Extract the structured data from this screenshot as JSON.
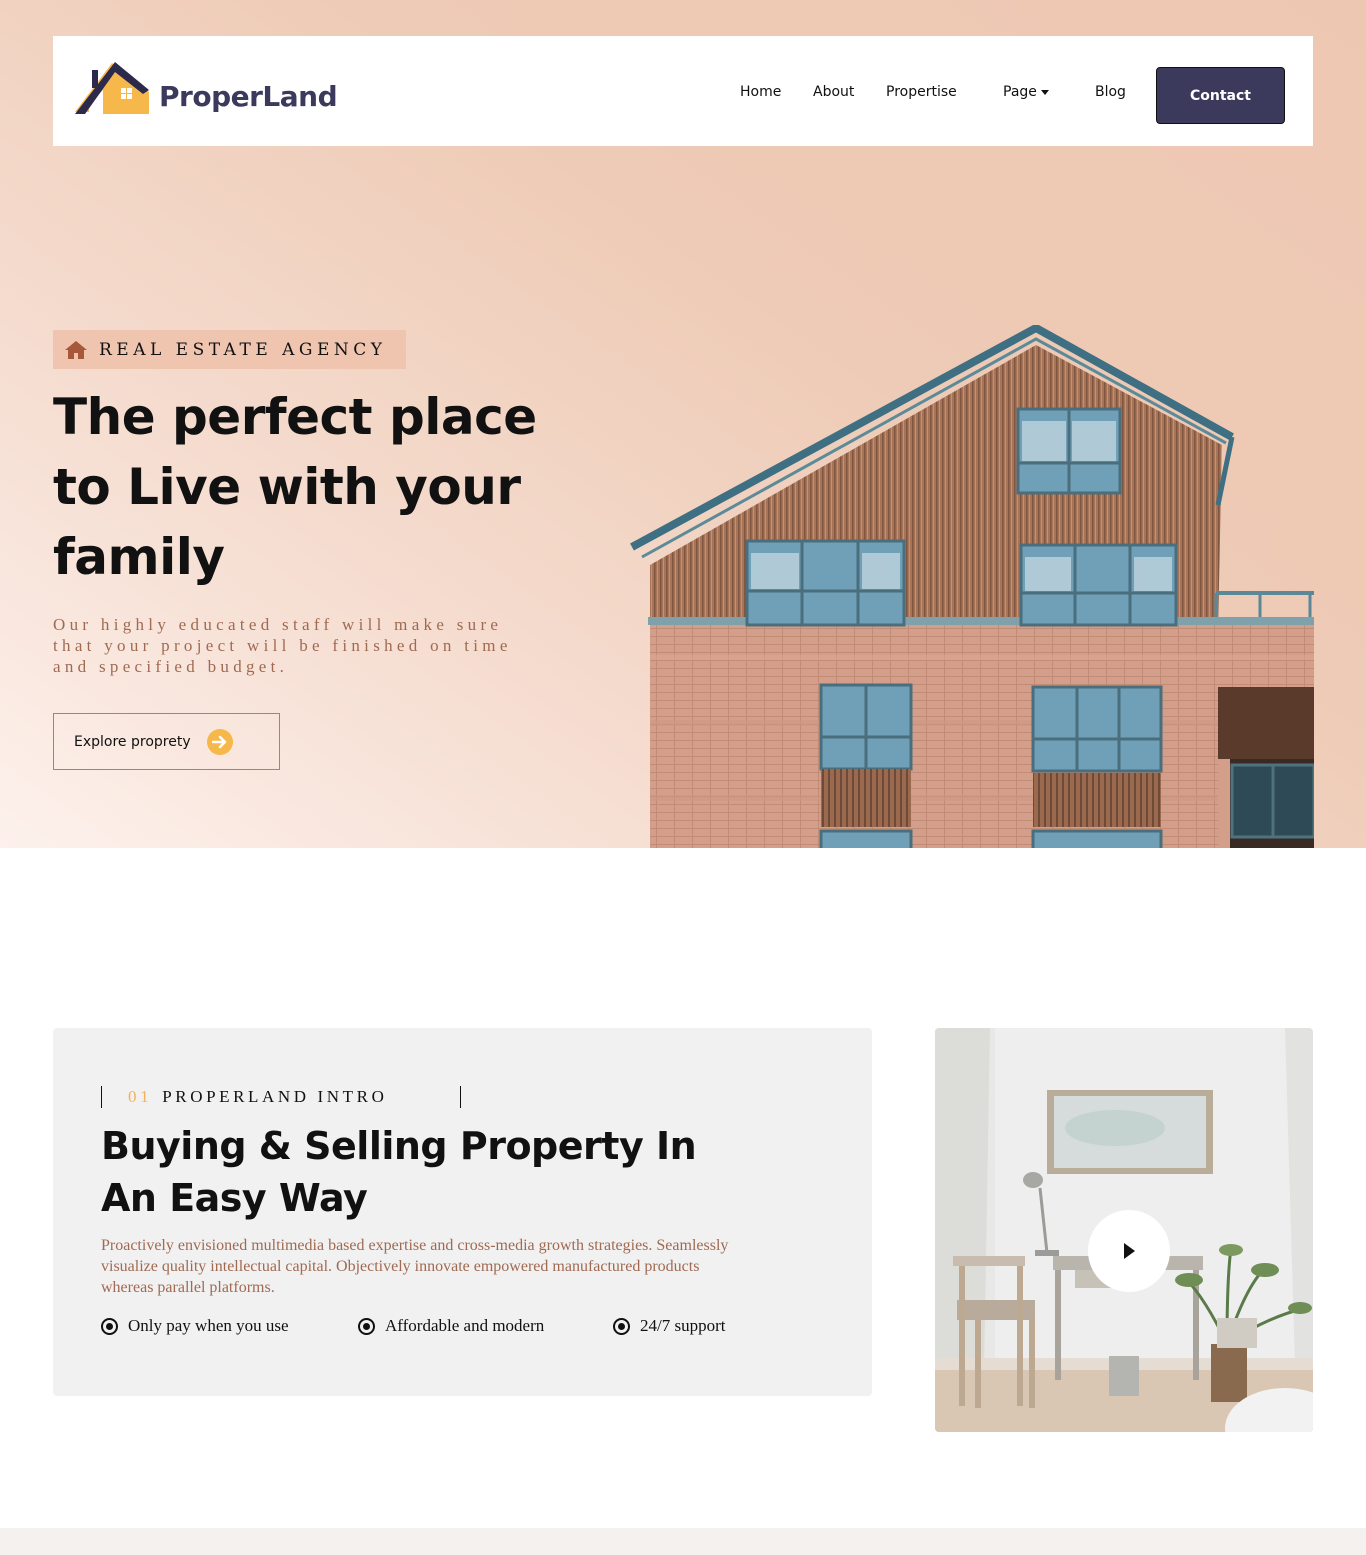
{
  "brand": {
    "name": "ProperLand",
    "colors": {
      "dark": "#3b3a5c",
      "accent": "#f7b84b",
      "muted": "#a06a52",
      "peach": "#eec7b2"
    }
  },
  "nav": {
    "items": [
      {
        "label": "Home"
      },
      {
        "label": "About"
      },
      {
        "label": "Propertise"
      },
      {
        "label": "Page",
        "has_dropdown": true
      },
      {
        "label": "Blog"
      }
    ],
    "contact_label": "Contact"
  },
  "hero": {
    "tagline": "REAL ESTATE AGENCY",
    "tagline_icon": "home-icon",
    "title": "The perfect place to Live with your family",
    "description": "Our highly educated staff will make sure that your project will be finished on time and specified budget.",
    "cta_label": "Explore proprety",
    "cta_icon": "arrow-right-icon"
  },
  "intro": {
    "number": "01",
    "label": "PROPERLAND INTRO",
    "title": "Buying & Selling Property In An Easy Way",
    "description": "Proactively envisioned multimedia based expertise and cross-media growth strategies. Seamlessly visualize quality intellectual capital. Objectively innovate empowered manufactured products whereas parallel platforms.",
    "features": [
      {
        "label": "Only pay when you use"
      },
      {
        "label": "Affordable and modern"
      },
      {
        "label": "24/7 support"
      }
    ],
    "video_icon": "play-icon"
  }
}
